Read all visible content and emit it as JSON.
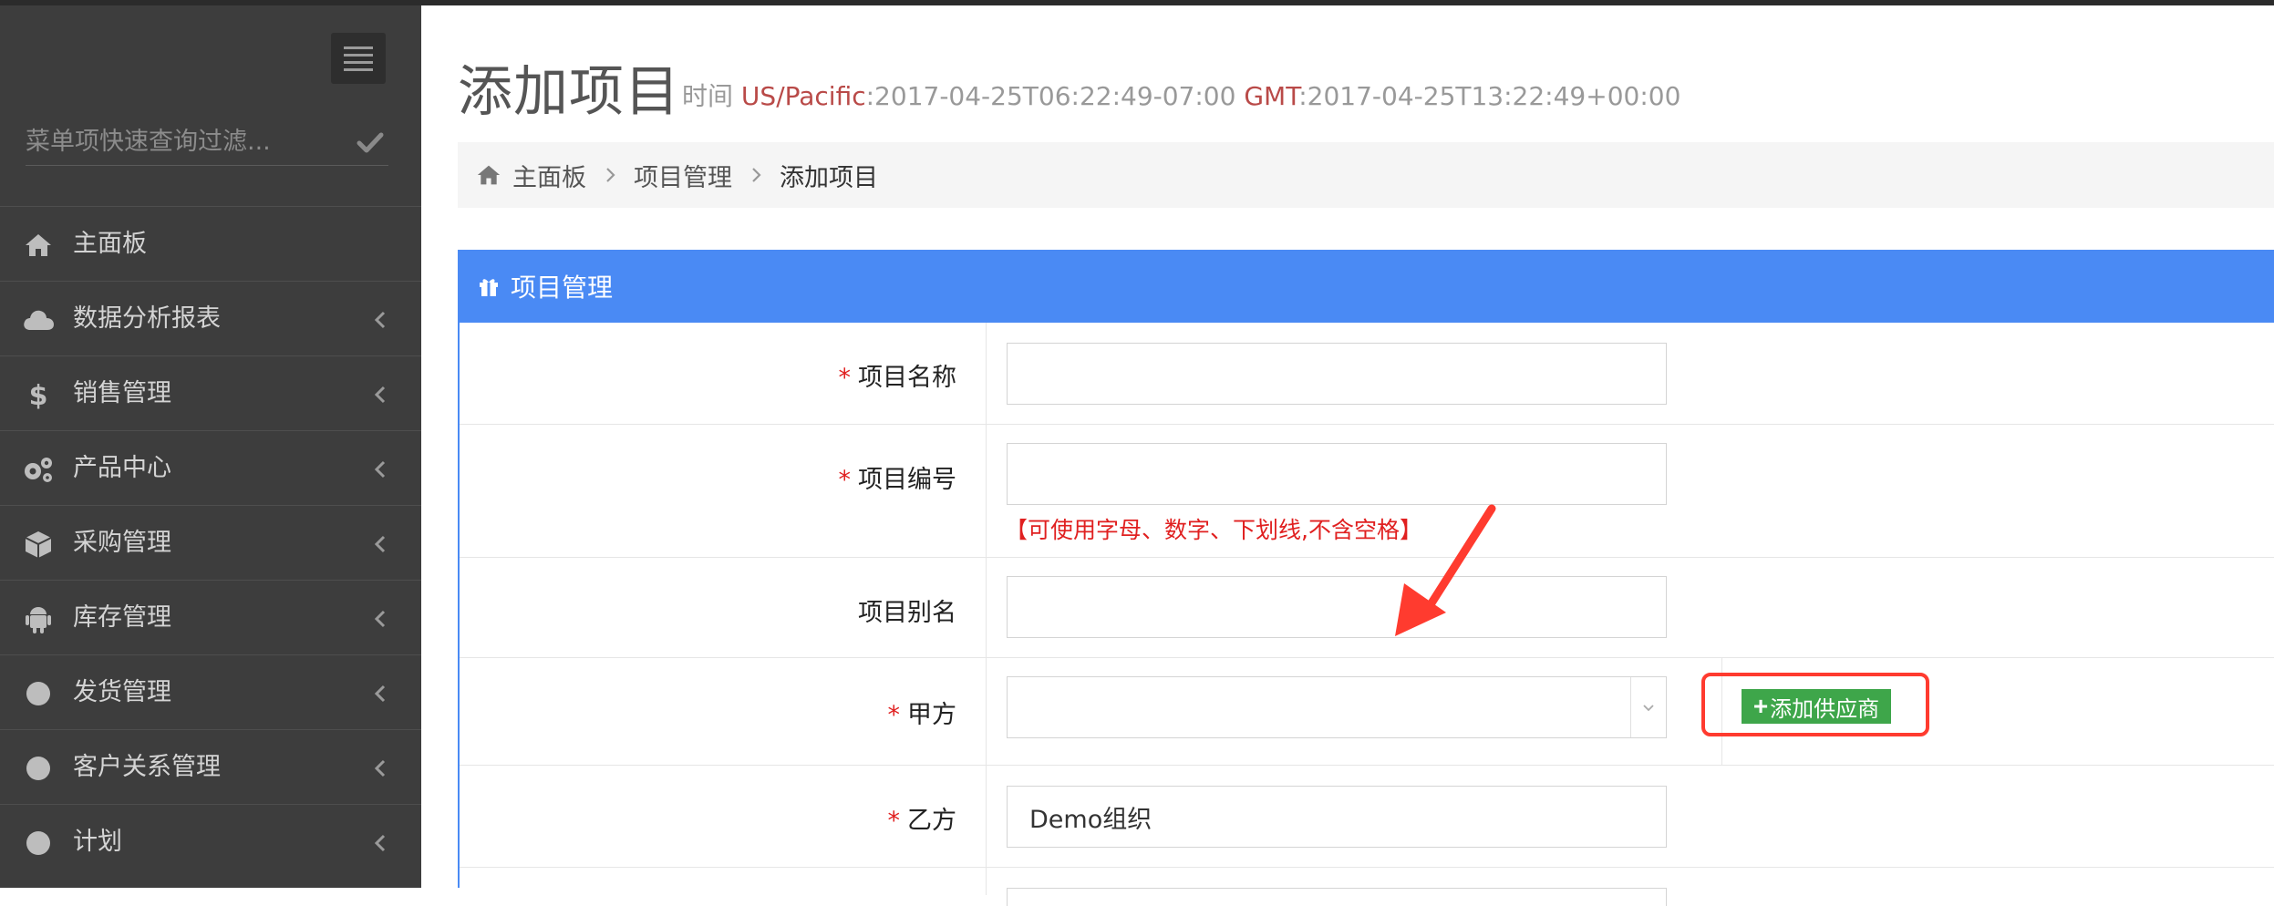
{
  "sidebar": {
    "filter_placeholder": "菜单项快速查询过滤...",
    "items": [
      {
        "label": "主面板",
        "icon": "home-icon",
        "has_submenu": false
      },
      {
        "label": "数据分析报表",
        "icon": "cloud-icon",
        "has_submenu": true
      },
      {
        "label": "销售管理",
        "icon": "dollar-icon",
        "has_submenu": true
      },
      {
        "label": "产品中心",
        "icon": "gears-icon",
        "has_submenu": true
      },
      {
        "label": "采购管理",
        "icon": "cube-icon",
        "has_submenu": true
      },
      {
        "label": "库存管理",
        "icon": "android-icon",
        "has_submenu": true
      },
      {
        "label": "发货管理",
        "icon": "circle-icon",
        "has_submenu": true
      },
      {
        "label": "客户关系管理",
        "icon": "circle-icon",
        "has_submenu": true
      },
      {
        "label": "计划",
        "icon": "circle-icon",
        "has_submenu": true
      }
    ]
  },
  "header": {
    "title": "添加项目",
    "time_label": "时间",
    "tz1_name": "US/Pacific",
    "tz1_value": ":2017-04-25T06:22:49-07:00",
    "tz2_name": "GMT",
    "tz2_value": ":2017-04-25T13:22:49+00:00"
  },
  "breadcrumb": {
    "items": [
      "主面板",
      "项目管理",
      "添加项目"
    ]
  },
  "panel": {
    "title": "项目管理"
  },
  "form": {
    "name": {
      "label": "项目名称",
      "required": "*",
      "value": ""
    },
    "code": {
      "label": "项目编号",
      "required": "*",
      "value": "",
      "hint": "【可使用字母、数字、下划线,不含空格】"
    },
    "alias": {
      "label": "项目别名",
      "value": ""
    },
    "party_a": {
      "label": "甲方",
      "required": "*",
      "value": "",
      "add_button": "添加供应商"
    },
    "party_b": {
      "label": "乙方",
      "required": "*",
      "value": "Demo组织"
    }
  },
  "colors": {
    "sidebar_bg": "#3d3d3d",
    "accent": "#4a8af4",
    "required": "#e02020",
    "add_button": "#3ea64a",
    "annotation": "#ff3b2f"
  }
}
